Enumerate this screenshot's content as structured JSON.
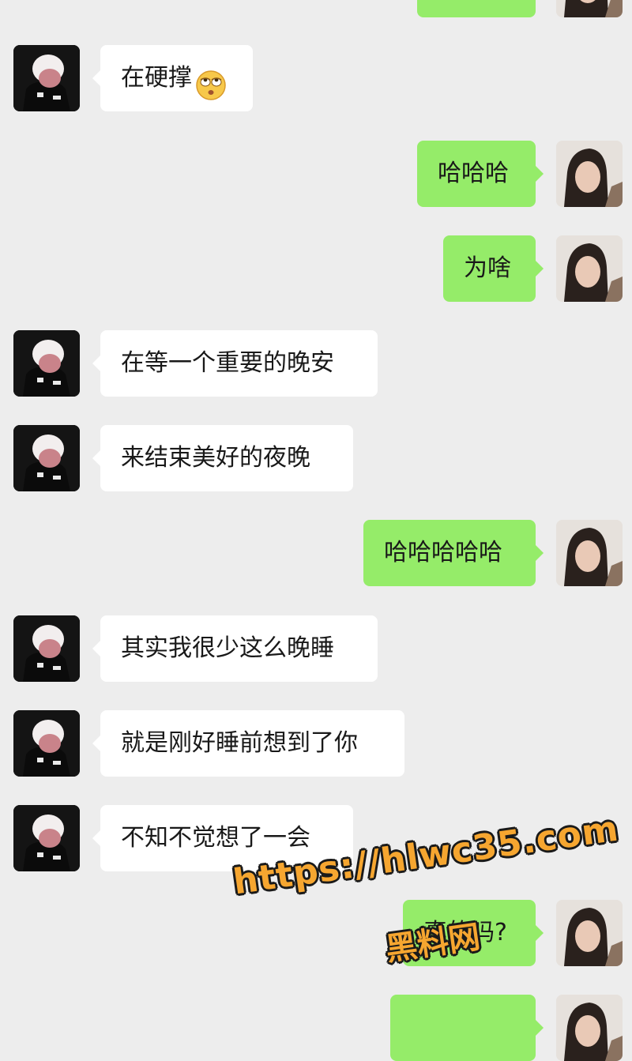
{
  "chat": {
    "colors": {
      "background": "#ededed",
      "incoming_bubble": "#ffffff",
      "outgoing_bubble": "#95ec69",
      "watermark": "#f6a630"
    },
    "messages": [
      {
        "side": "right",
        "text": "",
        "partial": true
      },
      {
        "side": "left",
        "text": "在硬撑",
        "emoji": "eye-roll-emoji"
      },
      {
        "side": "right",
        "text": "哈哈哈"
      },
      {
        "side": "right",
        "text": "为啥"
      },
      {
        "side": "left",
        "text": "在等一个重要的晚安"
      },
      {
        "side": "left",
        "text": "来结束美好的夜晚"
      },
      {
        "side": "right",
        "text": "哈哈哈哈哈"
      },
      {
        "side": "left",
        "text": "其实我很少这么晚睡"
      },
      {
        "side": "left",
        "text": "就是刚好睡前想到了你"
      },
      {
        "side": "left",
        "text": "不知不觉想了一会"
      },
      {
        "side": "right",
        "text": "真的吗?"
      },
      {
        "side": "right",
        "text": "",
        "partial": true
      }
    ]
  },
  "watermark": {
    "url": "https://hlwc35.com",
    "site_name": "黑料网"
  }
}
